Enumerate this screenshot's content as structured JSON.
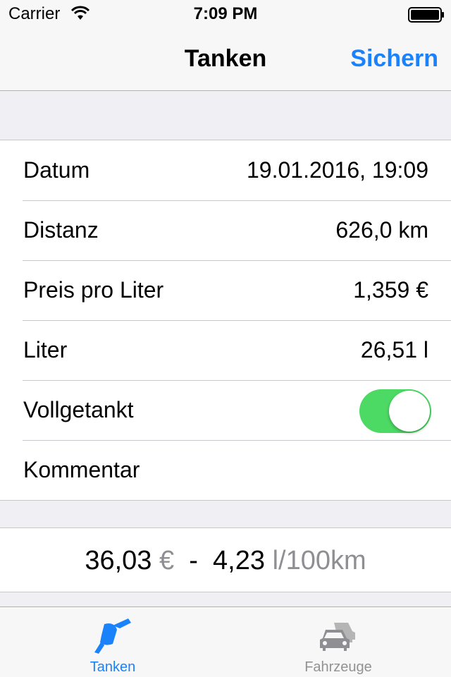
{
  "status_bar": {
    "carrier": "Carrier",
    "time": "7:09 PM"
  },
  "nav": {
    "title": "Tanken",
    "save_label": "Sichern"
  },
  "rows": [
    {
      "label": "Datum",
      "value": "19.01.2016, 19:09"
    },
    {
      "label": "Distanz",
      "value": "626,0 km"
    },
    {
      "label": "Preis pro Liter",
      "value": "1,359 €"
    },
    {
      "label": "Liter",
      "value": "26,51 l"
    },
    {
      "label": "Vollgetankt",
      "toggle_on": true
    },
    {
      "label": "Kommentar",
      "value": ""
    }
  ],
  "summary": {
    "price": "36,03",
    "price_unit": "€",
    "separator": "-",
    "consumption": "4,23",
    "consumption_unit": "l/100km"
  },
  "tabs": [
    {
      "label": "Tanken",
      "icon": "fuel-nozzle-icon",
      "active": true
    },
    {
      "label": "Fahrzeuge",
      "icon": "cars-icon",
      "active": false
    }
  ],
  "colors": {
    "accent": "#1a82fb",
    "toggle_on": "#4cd964",
    "inactive": "#929292"
  }
}
